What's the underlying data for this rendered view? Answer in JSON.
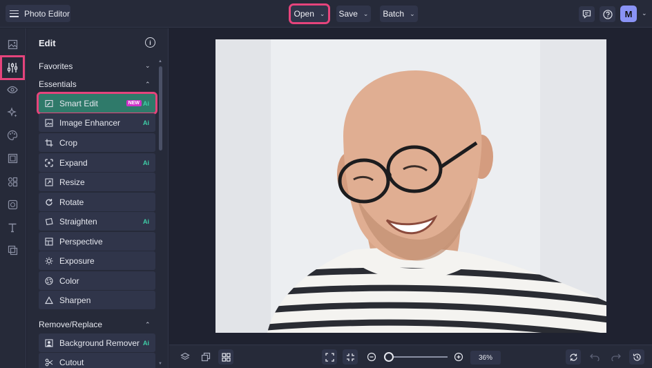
{
  "app": {
    "title": "Photo Editor",
    "menu_icon": "hamburger-icon"
  },
  "header": {
    "menus": [
      {
        "label": "Open",
        "highlighted": true
      },
      {
        "label": "Save",
        "highlighted": false
      },
      {
        "label": "Batch",
        "highlighted": false
      }
    ],
    "icons": [
      "chat-icon",
      "help-icon"
    ],
    "avatar_initial": "M"
  },
  "rail": {
    "icons": [
      "image-icon",
      "sliders-icon",
      "eye-icon",
      "sparkles-icon",
      "palette-icon",
      "frame-icon",
      "shapes-icon",
      "texture-icon",
      "text-icon",
      "graphics-icon"
    ],
    "active": "sliders-icon"
  },
  "panel": {
    "title": "Edit",
    "sections": {
      "favorites": "Favorites",
      "essentials": "Essentials",
      "remove_replace": "Remove/Replace"
    },
    "tools": [
      {
        "label": "Smart Edit",
        "badge_new": "NEW",
        "ai": "Ai",
        "selected": true
      },
      {
        "label": "Image Enhancer",
        "ai": "Ai"
      },
      {
        "label": "Crop"
      },
      {
        "label": "Expand",
        "ai": "Ai"
      },
      {
        "label": "Resize"
      },
      {
        "label": "Rotate"
      },
      {
        "label": "Straighten",
        "ai": "Ai"
      },
      {
        "label": "Perspective"
      },
      {
        "label": "Exposure"
      },
      {
        "label": "Color"
      },
      {
        "label": "Sharpen"
      }
    ],
    "remove_tools": [
      {
        "label": "Background Remover",
        "ai": "Ai"
      },
      {
        "label": "Cutout"
      }
    ]
  },
  "bottombar": {
    "zoom_label": "36%",
    "zoom_value": 0.36
  },
  "colors": {
    "accent_highlight": "#e6447c",
    "selected_tool": "#2f7a6a",
    "ai_badge": "#3fcfa8",
    "new_badge": "#d033c9",
    "avatar": "#8a93f5"
  }
}
